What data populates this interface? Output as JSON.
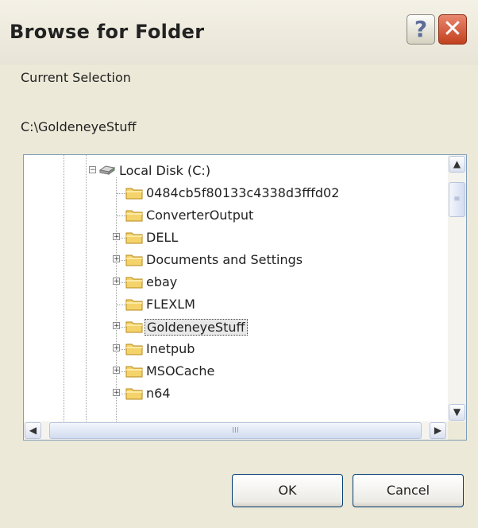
{
  "window": {
    "title": "Browse for Folder",
    "help_label": "?",
    "close_label": "✕"
  },
  "current_selection_label": "Current Selection",
  "current_path": "C:\\GoldeneyeStuff",
  "tree": {
    "root": {
      "label": "Local Disk (C:)",
      "expanded": true,
      "icon": "drive-icon"
    },
    "items": [
      {
        "label": "0484cb5f80133c4338d3fffd02",
        "expandable": false,
        "selected": false
      },
      {
        "label": "ConverterOutput",
        "expandable": false,
        "selected": false
      },
      {
        "label": "DELL",
        "expandable": true,
        "selected": false
      },
      {
        "label": "Documents and Settings",
        "expandable": true,
        "selected": false
      },
      {
        "label": "ebay",
        "expandable": true,
        "selected": false
      },
      {
        "label": "FLEXLM",
        "expandable": false,
        "selected": false
      },
      {
        "label": "GoldeneyeStuff",
        "expandable": true,
        "selected": true
      },
      {
        "label": "Inetpub",
        "expandable": true,
        "selected": false
      },
      {
        "label": "MSOCache",
        "expandable": true,
        "selected": false
      },
      {
        "label": "n64",
        "expandable": true,
        "selected": false
      }
    ]
  },
  "scrollbars": {
    "up": "▲",
    "down": "▼",
    "left": "◀",
    "right": "▶",
    "grip_v": "≡",
    "grip_h": "III"
  },
  "buttons": {
    "ok": "OK",
    "cancel": "Cancel"
  },
  "colors": {
    "dialog_bg": "#ece9d8",
    "close_red": "#c2401e",
    "folder_yellow": "#f5d36b"
  }
}
